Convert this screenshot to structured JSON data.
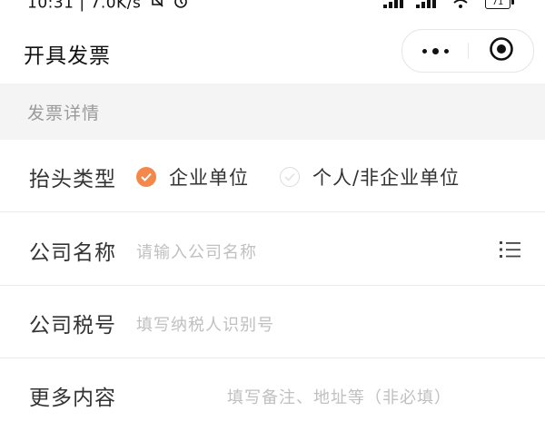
{
  "status_bar": {
    "time_speed": "10:31 | 7.0K/s",
    "battery": "71"
  },
  "nav": {
    "title": "开具发票"
  },
  "section": {
    "title": "发票详情"
  },
  "form": {
    "type_label": "抬头类型",
    "options": [
      "企业单位",
      "个人/非企业单位"
    ],
    "selected_option": "企业单位",
    "company_name_label": "公司名称",
    "company_name_placeholder": "请输入公司名称",
    "tax_id_label": "公司税号",
    "tax_id_placeholder": "填写纳税人识别号",
    "extra_label": "更多内容",
    "extra_placeholder": "填写备注、地址等（非必填）"
  },
  "colors": {
    "accent": "#f4884a",
    "section_bg": "#f4f4f4",
    "placeholder": "#c0c0c0"
  },
  "icons": {
    "more": "more-dots-icon",
    "close": "target-circle-icon",
    "list": "list-icon",
    "check": "checkmark-icon"
  }
}
